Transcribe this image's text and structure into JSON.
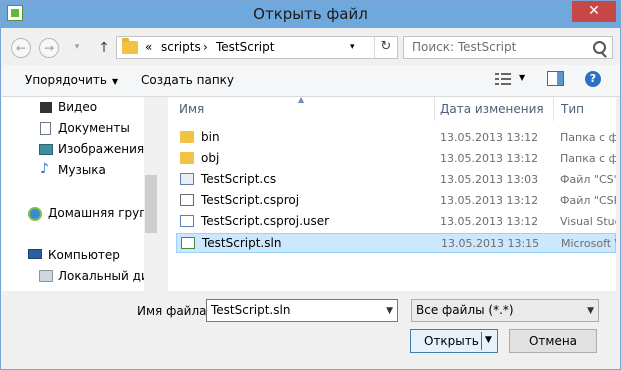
{
  "window": {
    "title": "Открыть файл",
    "close_glyph": "✕"
  },
  "nav": {
    "back_glyph": "←",
    "forward_glyph": "→",
    "up_glyph": "↑",
    "address": {
      "prefix": "«",
      "crumbs": [
        "scripts",
        "TestScript"
      ],
      "separator": "›",
      "refresh_glyph": "↻"
    },
    "search_placeholder": "Поиск: TestScript"
  },
  "toolbar": {
    "organize_label": "Упорядочить",
    "new_folder_label": "Создать папку",
    "help_glyph": "?"
  },
  "sidebar": {
    "items": [
      {
        "label": "Видео",
        "icon": "video-icon"
      },
      {
        "label": "Документы",
        "icon": "documents-icon"
      },
      {
        "label": "Изображения",
        "icon": "images-icon"
      },
      {
        "label": "Музыка",
        "icon": "music-icon"
      },
      {
        "label": "Домашняя групп",
        "icon": "homegroup-icon"
      },
      {
        "label": "Компьютер",
        "icon": "computer-icon"
      },
      {
        "label": "Локальный дис",
        "icon": "local-disk-icon"
      }
    ]
  },
  "file_list": {
    "columns": {
      "name": "Имя",
      "date": "Дата изменения",
      "type": "Тип"
    },
    "files": [
      {
        "name": "bin",
        "date": "13.05.2013 13:12",
        "type": "Папка с ф",
        "icon": "folder-icon",
        "selected": false
      },
      {
        "name": "obj",
        "date": "13.05.2013 13:12",
        "type": "Папка с ф",
        "icon": "folder-icon",
        "selected": false
      },
      {
        "name": "TestScript.cs",
        "date": "13.05.2013 13:03",
        "type": "Файл \"CS\"",
        "icon": "cs-file-icon",
        "selected": false
      },
      {
        "name": "TestScript.csproj",
        "date": "13.05.2013 13:12",
        "type": "Файл \"CSP",
        "icon": "csproj-file-icon",
        "selected": false
      },
      {
        "name": "TestScript.csproj.user",
        "date": "13.05.2013 13:12",
        "type": "Visual Stud",
        "icon": "user-file-icon",
        "selected": false
      },
      {
        "name": "TestScript.sln",
        "date": "13.05.2013 13:15",
        "type": "Microsoft V",
        "icon": "sln-file-icon",
        "selected": true
      }
    ]
  },
  "footer": {
    "filename_label": "Имя файла:",
    "filename_value": "TestScript.sln",
    "filter_value": "Все файлы (*.*)",
    "open_label": "Открыть",
    "cancel_label": "Отмена"
  },
  "colors": {
    "titlebar": "#6fa8dc",
    "close": "#c74747",
    "selection": "#cce8ff",
    "folder": "#f1c244",
    "accent": "#3c7fb1"
  }
}
